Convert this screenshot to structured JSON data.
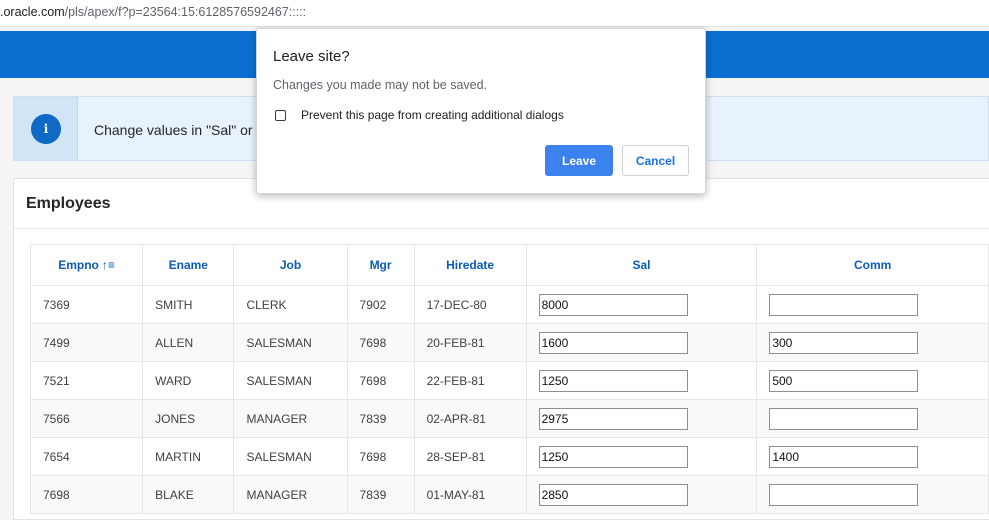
{
  "browser": {
    "url_host": ".oracle.com",
    "url_path": "/pls/apex/f?p=23564:15:6128576592467:::::"
  },
  "alert": {
    "icon": "info-icon",
    "icon_glyph": "i",
    "message": "Change values in \"Sal\" or \""
  },
  "region": {
    "title": "Employees"
  },
  "table": {
    "columns": [
      "Empno",
      "Ename",
      "Job",
      "Mgr",
      "Hiredate",
      "Sal",
      "Comm"
    ],
    "sort_icon": "↑≡",
    "rows": [
      {
        "empno": "7369",
        "ename": "SMITH",
        "job": "CLERK",
        "mgr": "7902",
        "hiredate": "17-DEC-80",
        "sal": "8000",
        "comm": ""
      },
      {
        "empno": "7499",
        "ename": "ALLEN",
        "job": "SALESMAN",
        "mgr": "7698",
        "hiredate": "20-FEB-81",
        "sal": "1600",
        "comm": "300"
      },
      {
        "empno": "7521",
        "ename": "WARD",
        "job": "SALESMAN",
        "mgr": "7698",
        "hiredate": "22-FEB-81",
        "sal": "1250",
        "comm": "500"
      },
      {
        "empno": "7566",
        "ename": "JONES",
        "job": "MANAGER",
        "mgr": "7839",
        "hiredate": "02-APR-81",
        "sal": "2975",
        "comm": ""
      },
      {
        "empno": "7654",
        "ename": "MARTIN",
        "job": "SALESMAN",
        "mgr": "7698",
        "hiredate": "28-SEP-81",
        "sal": "1250",
        "comm": "1400"
      },
      {
        "empno": "7698",
        "ename": "BLAKE",
        "job": "MANAGER",
        "mgr": "7839",
        "hiredate": "01-MAY-81",
        "sal": "2850",
        "comm": ""
      }
    ]
  },
  "dialog": {
    "title": "Leave site?",
    "message": "Changes you made may not be saved.",
    "checkbox_label": "Prevent this page from creating additional dialogs",
    "leave_label": "Leave",
    "cancel_label": "Cancel"
  },
  "colors": {
    "header_blue": "#0a6fd1",
    "link_blue": "#0b5cb8",
    "primary_button": "#3b82ee"
  }
}
